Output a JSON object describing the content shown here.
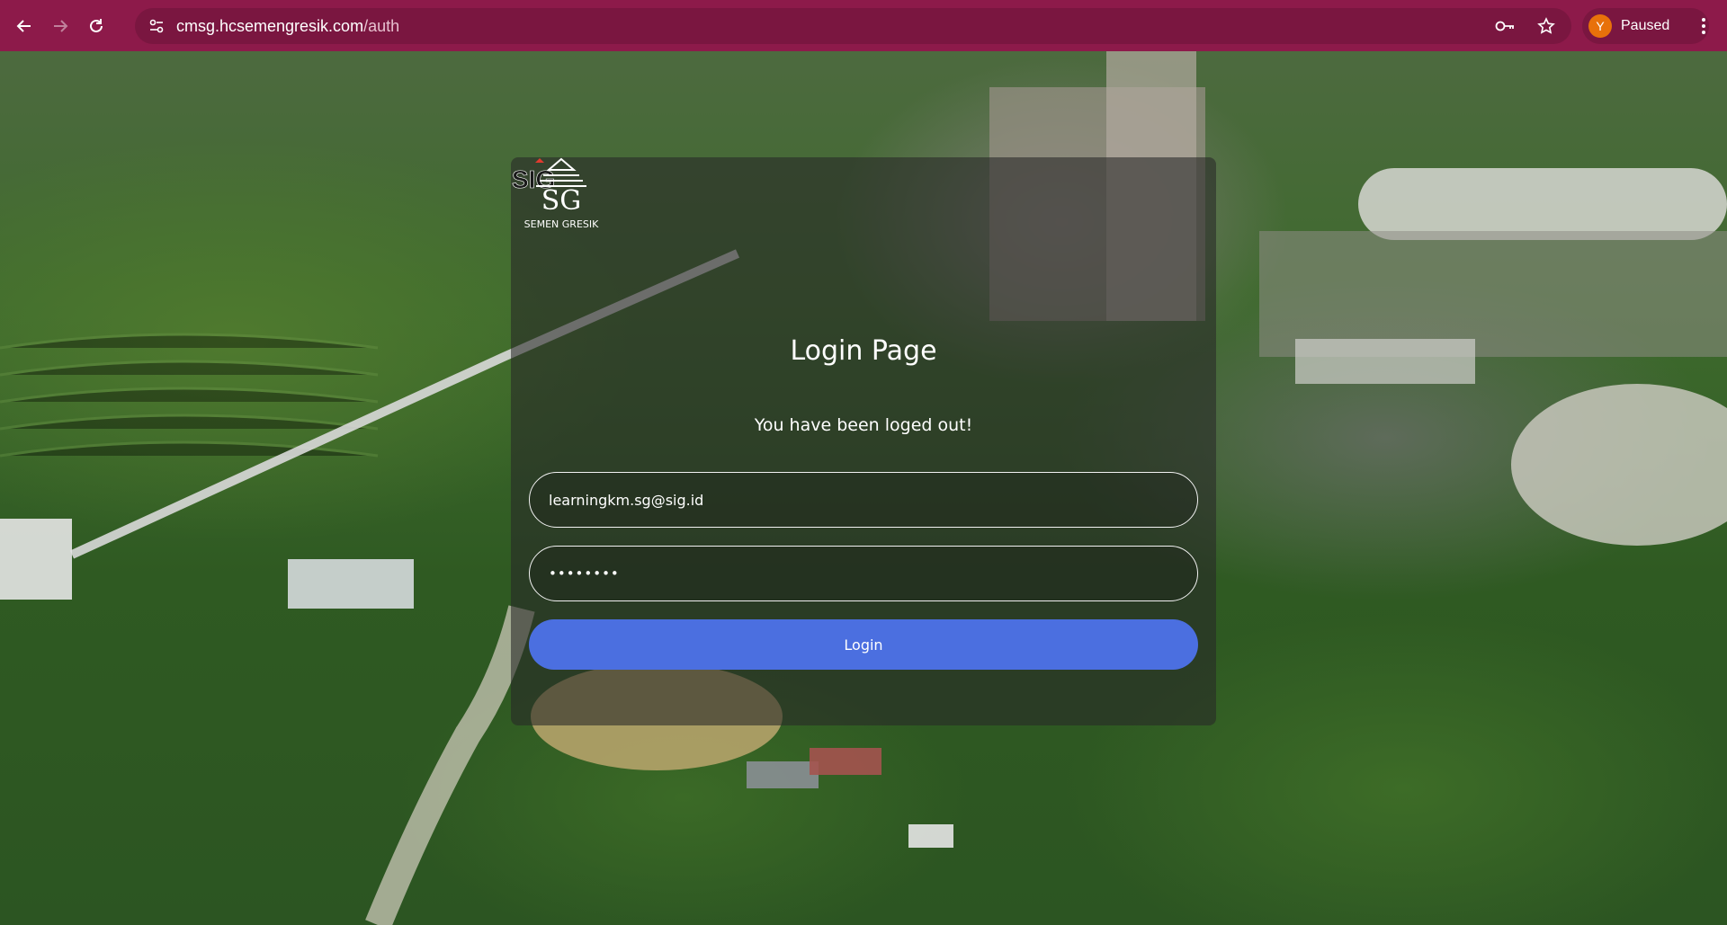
{
  "browser": {
    "url_host": "cmsg.hcsemengresik.com",
    "url_path": "/auth",
    "profile_initial": "Y",
    "profile_status": "Paused"
  },
  "login": {
    "title": "Login Page",
    "alert": "You have been loged out!",
    "email_value": "learningkm.sg@sig.id",
    "password_mask": "••••••••",
    "button_label": "Login",
    "sig_logo_text": "SIG",
    "emblem_text": "SEMEN GRESIK"
  },
  "colors": {
    "chrome_bg": "#8d1a4a",
    "button_bg": "#4b6fe0"
  }
}
